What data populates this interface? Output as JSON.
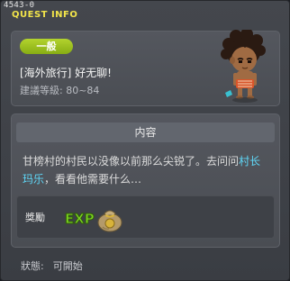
{
  "window": {
    "quest_id": "4543-0",
    "title": "QUEST INFO"
  },
  "quest": {
    "category": "一般",
    "name": "[海外旅行] 好无聊!",
    "level_text": "建議等級: 80~84"
  },
  "content": {
    "header": "内容",
    "description_before": "甘榜村的村民以没像以前那么尖锐了。去问问",
    "npc_name": "村长玛乐",
    "description_after": "，看看他需要什么…"
  },
  "reward": {
    "label": "獎勵",
    "items": [
      "exp-icon",
      "money-bag-icon"
    ]
  },
  "status": {
    "label": "狀態:",
    "value": "可開始"
  },
  "colors": {
    "title": "#f2e44a",
    "badge": "#9cc11f",
    "npc_link": "#5fd7f7"
  }
}
